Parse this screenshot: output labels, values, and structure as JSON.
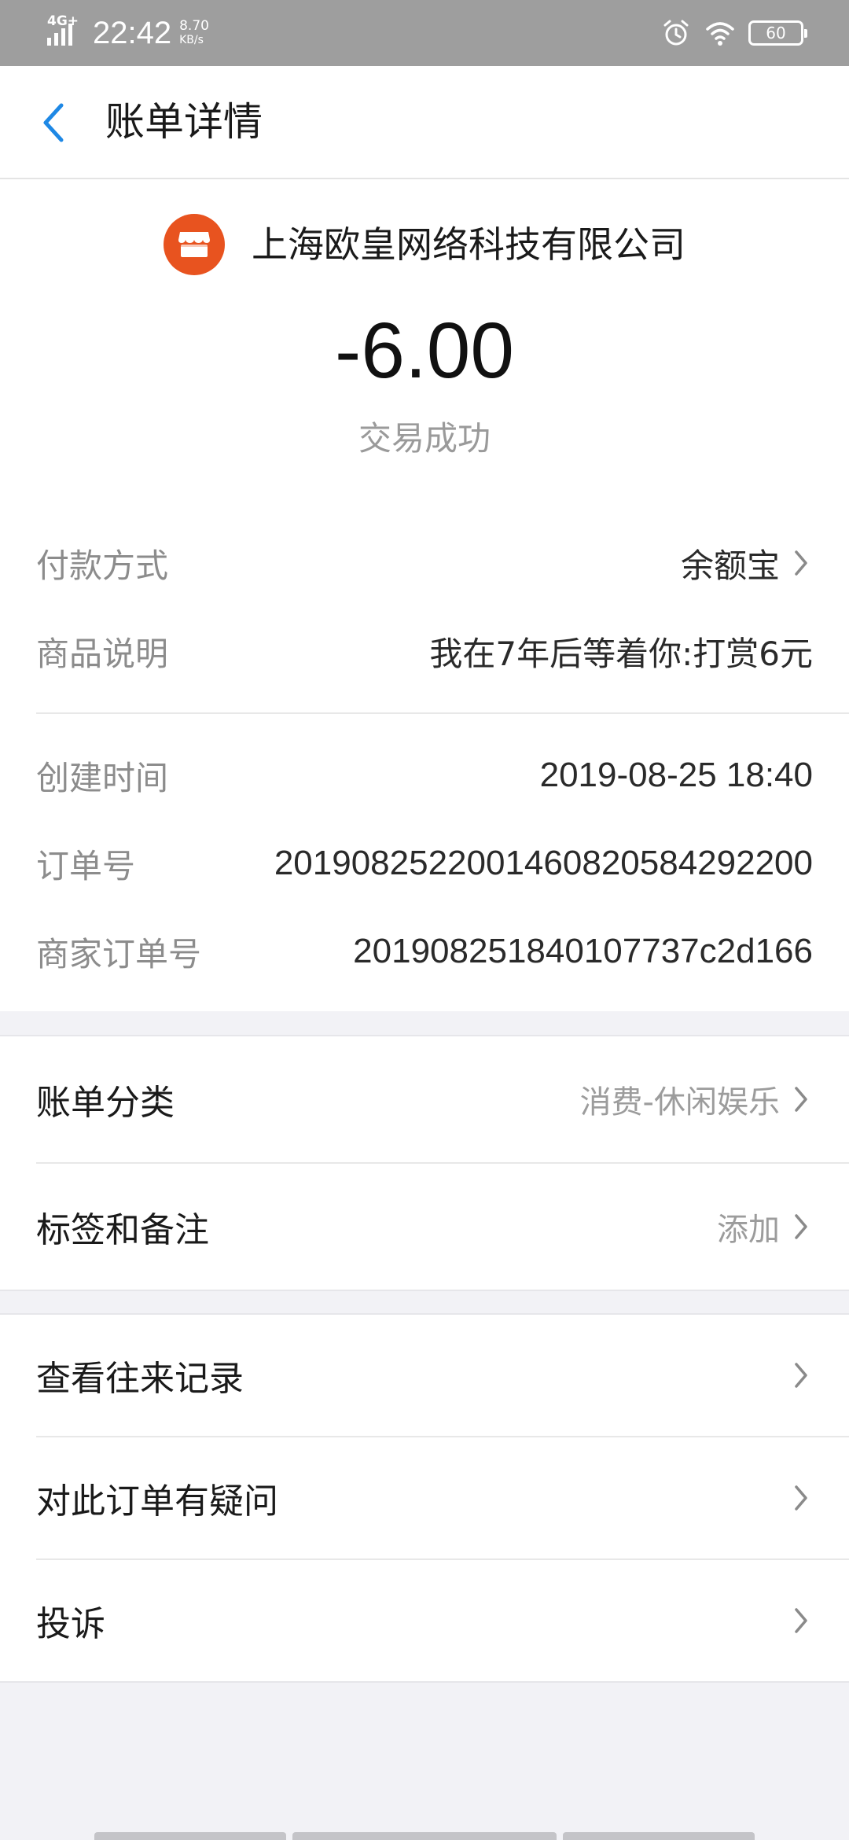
{
  "status_bar": {
    "network": "4G+",
    "time": "22:42",
    "speed_value": "8.70",
    "speed_unit": "KB/s",
    "battery": "60"
  },
  "nav": {
    "title": "账单详情"
  },
  "header": {
    "merchant": "上海欧皇网络科技有限公司",
    "amount": "-6.00",
    "status": "交易成功",
    "logo_color": "#e8531f"
  },
  "details": [
    {
      "label": "付款方式",
      "value": "余额宝"
    },
    {
      "label": "商品说明",
      "value": "我在7年后等着你:打赏6元"
    },
    {
      "label": "创建时间",
      "value": "2019-08-25 18:40"
    },
    {
      "label": "订单号",
      "value": "2019082522001460820584292200"
    },
    {
      "label": "商家订单号",
      "value": "201908251840107737c2d166"
    }
  ],
  "bill_section": [
    {
      "label": "账单分类",
      "value": "消费-休闲娱乐"
    },
    {
      "label": "标签和备注",
      "value": "添加"
    }
  ],
  "actions": [
    {
      "label": "查看往来记录"
    },
    {
      "label": "对此订单有疑问"
    },
    {
      "label": "投诉"
    }
  ],
  "colors": {
    "accent": "#1e88e5",
    "background": "#f2f2f6",
    "status_bar": "#9e9e9e"
  }
}
